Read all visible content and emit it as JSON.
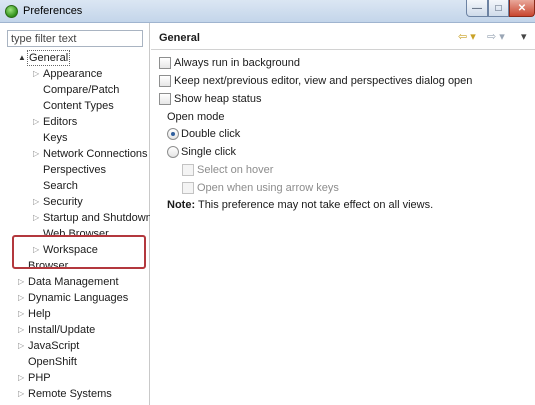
{
  "window": {
    "title": "Preferences",
    "controls": {
      "minimize": "—",
      "maximize": "□",
      "close": "✕"
    }
  },
  "filter": {
    "placeholder": "type filter text",
    "value": ""
  },
  "tree": {
    "items": [
      {
        "label": "General",
        "expander": "▲",
        "state": "expanded",
        "selected": true
      },
      {
        "label": "Appearance",
        "expander": "▷"
      },
      {
        "label": "Compare/Patch",
        "expander": ""
      },
      {
        "label": "Content Types",
        "expander": ""
      },
      {
        "label": "Editors",
        "expander": "▷"
      },
      {
        "label": "Keys",
        "expander": ""
      },
      {
        "label": "Network Connections",
        "expander": "▷"
      },
      {
        "label": "Perspectives",
        "expander": ""
      },
      {
        "label": "Search",
        "expander": ""
      },
      {
        "label": "Security",
        "expander": "▷"
      },
      {
        "label": "Startup and Shutdown",
        "expander": "▷"
      },
      {
        "label": "Web Browser",
        "expander": ""
      },
      {
        "label": "Workspace",
        "expander": "▷"
      },
      {
        "label": "Browser",
        "expander": ""
      },
      {
        "label": "Data Management",
        "expander": "▷"
      },
      {
        "label": "Dynamic Languages",
        "expander": "▷"
      },
      {
        "label": "Help",
        "expander": "▷"
      },
      {
        "label": "Install/Update",
        "expander": "▷"
      },
      {
        "label": "JavaScript",
        "expander": "▷"
      },
      {
        "label": "OpenShift",
        "expander": ""
      },
      {
        "label": "PHP",
        "expander": "▷"
      },
      {
        "label": "Remote Systems",
        "expander": "▷"
      }
    ]
  },
  "page": {
    "title": "General",
    "nav": {
      "back": "⇦ ▾",
      "forward": "⇨ ▾",
      "menu": "▾"
    },
    "options": [
      {
        "label": "Always run in background",
        "checked": false
      },
      {
        "label": "Keep next/previous editor, view and perspectives dialog open",
        "checked": false
      },
      {
        "label": "Show heap status",
        "checked": false
      }
    ],
    "open_mode": {
      "label": "Open mode",
      "choices": [
        {
          "label": "Double click",
          "selected": true
        },
        {
          "label": "Single click",
          "selected": false
        }
      ],
      "sub_options": [
        {
          "label": "Select on hover",
          "checked": false,
          "enabled": false
        },
        {
          "label": "Open when using arrow keys",
          "checked": false,
          "enabled": false
        }
      ]
    },
    "note": {
      "bold": "Note:",
      "text": "This preference may not take effect on all views."
    }
  }
}
